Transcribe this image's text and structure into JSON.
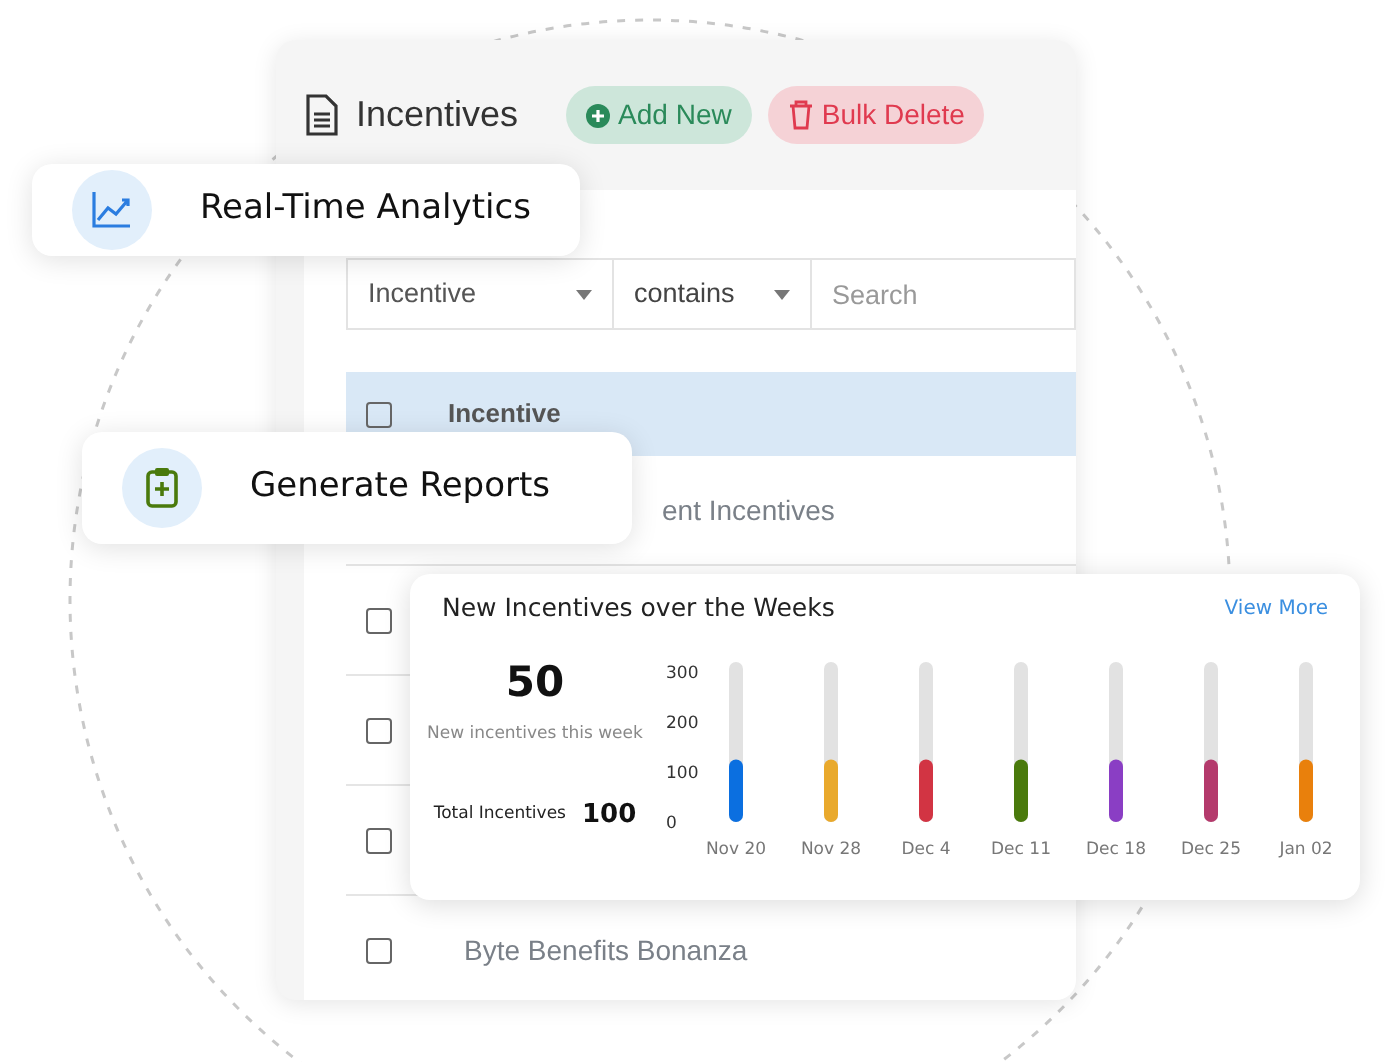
{
  "panel": {
    "title": "Incentives",
    "buttons": [
      {
        "kind": "add",
        "label": "Add New"
      },
      {
        "kind": "delete",
        "label": "Bulk Delete"
      }
    ],
    "filter": {
      "field": "Incentive",
      "operator": "contains",
      "search": {
        "placeholder": "Search"
      }
    },
    "table": {
      "columns": [
        {
          "label": "Incentive"
        }
      ],
      "header_checked": false,
      "rows": [
        {
          "name": "ent Incentives"
        },
        {
          "name": "",
          "checked": false
        },
        {
          "name": "",
          "checked": false
        },
        {
          "name": "",
          "checked": false
        },
        {
          "name": "Byte Benefits Bonanza",
          "checked": false
        }
      ]
    }
  },
  "features": [
    {
      "kind": "analytics",
      "label": "Real-Time Analytics"
    },
    {
      "kind": "reports",
      "label": "Generate Reports"
    }
  ],
  "chart_card": {
    "title": "New Incentives over the Weeks",
    "link": "View More",
    "count": "50",
    "count_caption": "New incentives this week",
    "total_label": "Total Incentives",
    "total": "100",
    "chart_data": {
      "type": "bar",
      "categories": [
        "Nov 20",
        "Nov 28",
        "Dec 4",
        "Dec 11",
        "Dec 18",
        "Dec 25",
        "Jan 02"
      ],
      "ylim": [
        0,
        300
      ],
      "yticks": [
        0,
        100,
        200,
        300
      ],
      "series": [
        {
          "values": [
            125,
            125,
            125,
            125,
            125,
            125,
            125
          ],
          "colors": [
            "#0b6fe0",
            "#e9a92c",
            "#d23443",
            "#4a7a0c",
            "#8a3ec4",
            "#b43a6c",
            "#e9800c"
          ]
        }
      ]
    }
  }
}
